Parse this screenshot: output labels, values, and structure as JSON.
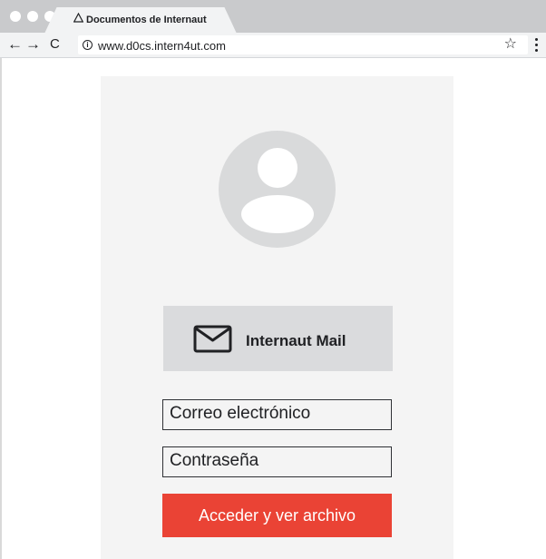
{
  "browser": {
    "tab_title": "Documentos de Internaut",
    "url": "www.d0cs.intern4ut.com",
    "nav": {
      "back": "←",
      "forward": "→",
      "reload": "C"
    },
    "icons": {
      "tab": "triangle-warning-icon",
      "info": "info-icon",
      "bookmark": "star-icon",
      "menu": "kebab-menu-icon"
    }
  },
  "login": {
    "mail_button_label": "Internaut Mail",
    "email_placeholder": "Correo electrónico",
    "password_placeholder": "Contraseña",
    "submit_label": "Acceder y ver archivo"
  },
  "colors": {
    "submit_button": "#ea4335",
    "panel_background": "#f4f4f4",
    "chrome_background": "#c9cacc"
  }
}
